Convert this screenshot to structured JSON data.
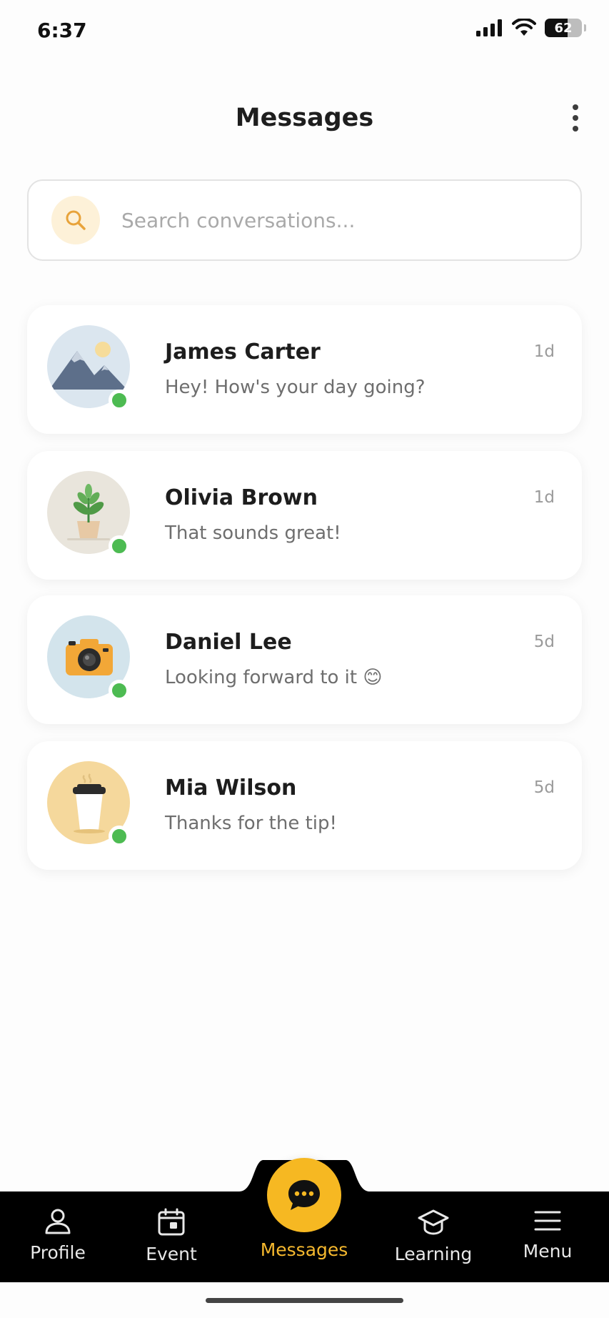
{
  "status_bar": {
    "time": "6:37",
    "battery": "62"
  },
  "header": {
    "title": "Messages"
  },
  "search": {
    "placeholder": "Search conversations..."
  },
  "conversations": [
    {
      "name": "James Carter",
      "preview": "Hey! How's your day going?",
      "time": "1d",
      "avatar": "mountain-avatar",
      "online": true
    },
    {
      "name": "Olivia Brown",
      "preview": "That sounds great!",
      "time": "1d",
      "avatar": "plant-avatar",
      "online": true
    },
    {
      "name": "Daniel Lee",
      "preview": "Looking forward to it 😊",
      "time": "5d",
      "avatar": "camera-avatar",
      "online": true
    },
    {
      "name": "Mia Wilson",
      "preview": "Thanks for the tip!",
      "time": "5d",
      "avatar": "coffee-cup-avatar",
      "online": true
    }
  ],
  "bottom_nav": {
    "items": [
      {
        "label": "Profile",
        "icon": "person-icon"
      },
      {
        "label": "Event",
        "icon": "calendar-icon"
      },
      {
        "label": "Messages",
        "icon": "chat-bubble-icon",
        "active": true
      },
      {
        "label": "Learning",
        "icon": "graduation-cap-icon"
      },
      {
        "label": "Menu",
        "icon": "hamburger-icon"
      }
    ]
  },
  "colors": {
    "accent": "#f6b822",
    "online": "#4dbb52",
    "nav_background": "#000000"
  }
}
